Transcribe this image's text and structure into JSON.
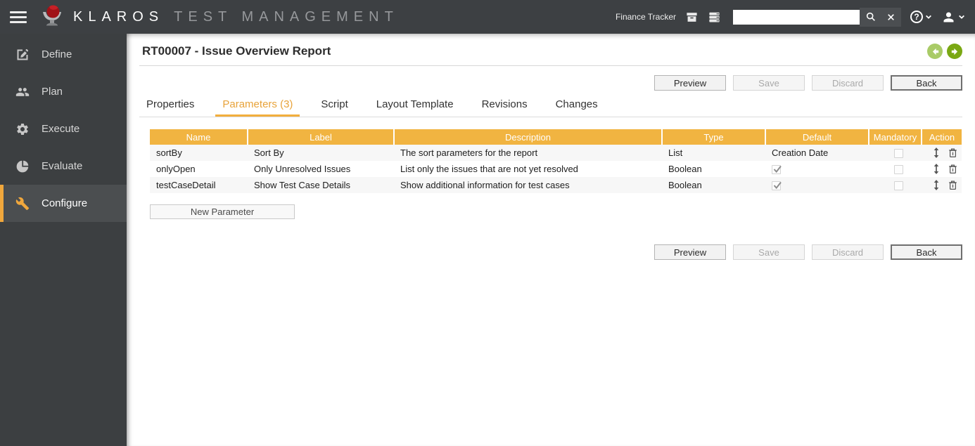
{
  "topbar": {
    "brand_primary": "KLAROS",
    "brand_secondary": "TEST MANAGEMENT",
    "project_label": "Finance Tracker",
    "search": {
      "value": "",
      "placeholder": ""
    }
  },
  "sidebar": {
    "items": [
      {
        "label": "Define",
        "icon": "edit",
        "active": false
      },
      {
        "label": "Plan",
        "icon": "users",
        "active": false
      },
      {
        "label": "Execute",
        "icon": "gear",
        "active": false
      },
      {
        "label": "Evaluate",
        "icon": "pie-chart",
        "active": false
      },
      {
        "label": "Configure",
        "icon": "wrench",
        "active": true
      }
    ]
  },
  "page": {
    "title": "RT00007 - Issue Overview Report",
    "tabs": [
      {
        "label": "Properties",
        "active": false
      },
      {
        "label": "Parameters (3)",
        "active": true
      },
      {
        "label": "Script",
        "active": false
      },
      {
        "label": "Layout Template",
        "active": false
      },
      {
        "label": "Revisions",
        "active": false
      },
      {
        "label": "Changes",
        "active": false
      }
    ],
    "actions": [
      {
        "label": "Preview",
        "enabled": true,
        "emphasis": false
      },
      {
        "label": "Save",
        "enabled": false,
        "emphasis": false
      },
      {
        "label": "Discard",
        "enabled": false,
        "emphasis": false
      },
      {
        "label": "Back",
        "enabled": true,
        "emphasis": true
      }
    ]
  },
  "table": {
    "headers": [
      "Name",
      "Label",
      "Description",
      "Type",
      "Default",
      "Mandatory",
      "Action"
    ],
    "rows": [
      {
        "name": "sortBy",
        "label": "Sort By",
        "description": "The sort parameters for the report",
        "type": "List",
        "default_text": "Creation Date",
        "default_checked": false,
        "mandatory_checked": false
      },
      {
        "name": "onlyOpen",
        "label": "Only Unresolved Issues",
        "description": "List only the issues that are not yet resolved",
        "type": "Boolean",
        "default_text": "",
        "default_checked": true,
        "mandatory_checked": false
      },
      {
        "name": "testCaseDetail",
        "label": "Show Test Case Details",
        "description": "Show additional information for test cases",
        "type": "Boolean",
        "default_text": "",
        "default_checked": true,
        "mandatory_checked": false
      }
    ],
    "new_parameter_label": "New Parameter"
  },
  "colors": {
    "topbar_bg": "#3d4043",
    "sidebar_bg": "#3c3f41",
    "sidebar_active_bg": "#4b4e50",
    "accent_orange": "#f1b441",
    "sidebar_accent_orange": "#f0a73c",
    "active_tab_text": "#e8a33a",
    "prev_arrow_green": "#a9cb67",
    "next_arrow_green": "#7aa813"
  }
}
